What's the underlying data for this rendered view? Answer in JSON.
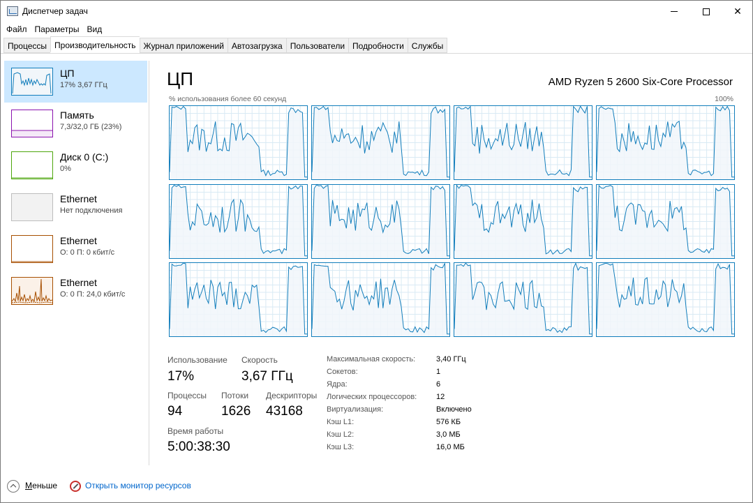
{
  "window": {
    "title": "Диспетчер задач",
    "controls": [
      "minimize",
      "maximize",
      "close"
    ]
  },
  "menu": [
    "Файл",
    "Параметры",
    "Вид"
  ],
  "tabs": [
    {
      "label": "Процессы"
    },
    {
      "label": "Производительность",
      "active": true
    },
    {
      "label": "Журнал приложений"
    },
    {
      "label": "Автозагрузка"
    },
    {
      "label": "Пользователи"
    },
    {
      "label": "Подробности"
    },
    {
      "label": "Службы"
    }
  ],
  "sidebar": {
    "items": [
      {
        "title": "ЦП",
        "subtitle": "17% 3,67 ГГц",
        "selected": true,
        "color": "#117dbb",
        "icon": "cpu-graph"
      },
      {
        "title": "Память",
        "subtitle": "7,3/32,0 ГБ (23%)",
        "color": "#8b12ae",
        "icon": "memory-graph"
      },
      {
        "title": "Диск 0 (C:)",
        "subtitle": "0%",
        "color": "#4da60c",
        "icon": "disk-graph"
      },
      {
        "title": "Ethernet",
        "subtitle": "Нет подключения",
        "color": "#a0a0a0",
        "icon": "ethernet-graph"
      },
      {
        "title": "Ethernet",
        "subtitle": "О: 0 П: 0 кбит/с",
        "color": "#a74f01",
        "icon": "ethernet-graph"
      },
      {
        "title": "Ethernet",
        "subtitle": "О: 0 П: 24,0 кбит/с",
        "color": "#a74f01",
        "icon": "ethernet-graph"
      }
    ]
  },
  "main": {
    "title": "ЦП",
    "cpu_name": "AMD Ryzen 5 2600 Six-Core Processor",
    "graph_label": "% использования более 60 секунд",
    "graph_max": "100%",
    "accent": "#117dbb",
    "fill": "#f1f6fa",
    "grid_color": "#d9eaf4"
  },
  "stats": {
    "usage_label": "Использование",
    "usage_value": "17%",
    "speed_label": "Скорость",
    "speed_value": "3,67 ГГц",
    "processes_label": "Процессы",
    "processes_value": "94",
    "threads_label": "Потоки",
    "threads_value": "1626",
    "handles_label": "Дескрипторы",
    "handles_value": "43168",
    "uptime_label": "Время работы",
    "uptime_value": "5:00:38:30"
  },
  "details": [
    {
      "label": "Максимальная скорость:",
      "value": "3,40 ГГц"
    },
    {
      "label": "Сокетов:",
      "value": "1"
    },
    {
      "label": "Ядра:",
      "value": "6"
    },
    {
      "label": "Логических процессоров:",
      "value": "12"
    },
    {
      "label": "Виртуализация:",
      "value": "Включено"
    },
    {
      "label": "Кэш L1:",
      "value": "576 КБ"
    },
    {
      "label": "Кэш L2:",
      "value": "3,0 МБ"
    },
    {
      "label": "Кэш L3:",
      "value": "16,0 МБ"
    }
  ],
  "footer": {
    "fewer_label": "Меньше",
    "resmon_label": "Открыть монитор ресурсов"
  }
}
